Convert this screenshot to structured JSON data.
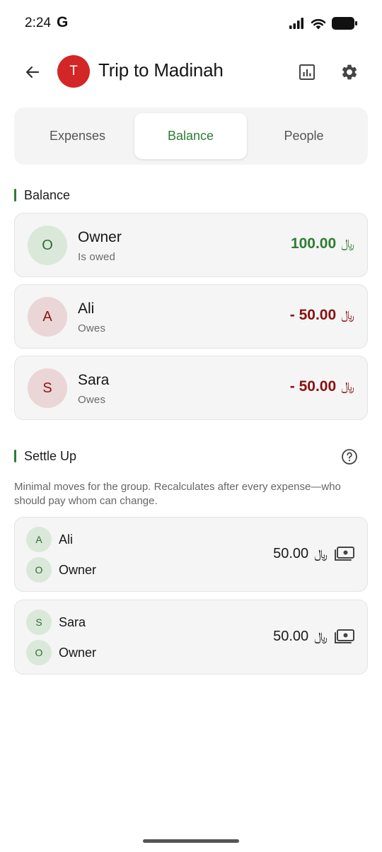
{
  "status_bar": {
    "time": "2:24",
    "carrier_icon": "G"
  },
  "header": {
    "avatar_letter": "T",
    "title": "Trip to Madinah",
    "icons": [
      "back-arrow-icon",
      "stats-chart-icon",
      "gear-icon"
    ]
  },
  "tabs": [
    {
      "label": "Expenses",
      "active": false
    },
    {
      "label": "Balance",
      "active": true
    },
    {
      "label": "People",
      "active": false
    }
  ],
  "balance_section": {
    "title": "Balance",
    "currency": "﷼",
    "items": [
      {
        "initial": "O",
        "name": "Owner",
        "status": "Is owed",
        "amount": "100.00",
        "direction": "positive"
      },
      {
        "initial": "A",
        "name": "Ali",
        "status": "Owes",
        "amount": "- 50.00",
        "direction": "negative"
      },
      {
        "initial": "S",
        "name": "Sara",
        "status": "Owes",
        "amount": "- 50.00",
        "direction": "negative"
      }
    ]
  },
  "settle_section": {
    "title": "Settle Up",
    "description": "Minimal moves for the group. Recalculates after every expense—who should pay whom can change.",
    "currency": "﷼",
    "transfers": [
      {
        "from_initial": "A",
        "from": "Ali",
        "to_initial": "O",
        "to": "Owner",
        "amount": "50.00"
      },
      {
        "from_initial": "S",
        "from": "Sara",
        "to_initial": "O",
        "to": "Owner",
        "amount": "50.00"
      }
    ]
  },
  "colors": {
    "accent_green": "#2e7d32",
    "negative_red": "#8b1010",
    "trip_avatar": "#d32626"
  }
}
